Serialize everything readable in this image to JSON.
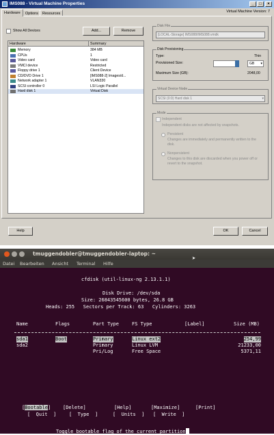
{
  "vm_window": {
    "title": "IMS088 - Virtual Machine Properties",
    "vm_name": "Virtual Machine Version: 7",
    "tabs": [
      "Hardware",
      "Options",
      "Resources"
    ],
    "show_all_devices": "Show All Devices",
    "add_button": "Add...",
    "remove_button": "Remove",
    "columns": [
      "Hardware",
      "Summary"
    ],
    "hardware": [
      {
        "icon": "memory-icon",
        "name": "Memory",
        "summary": "384 MB"
      },
      {
        "icon": "cpu-icon",
        "name": "CPUs",
        "summary": "1"
      },
      {
        "icon": "display-icon",
        "name": "Video card",
        "summary": "Video card"
      },
      {
        "icon": "pci-icon",
        "name": "VMCI device",
        "summary": "Restricted"
      },
      {
        "icon": "floppy-icon",
        "name": "Floppy drive 1",
        "summary": "Client Device"
      },
      {
        "icon": "cdrom-icon",
        "name": "CD/DVD Drive 1",
        "summary": "[IMS088-2] Images/d..."
      },
      {
        "icon": "network-icon",
        "name": "Network adapter 1",
        "summary": "VLAN330"
      },
      {
        "icon": "scsi-icon",
        "name": "SCSI controller 0",
        "summary": "LSI Logic Parallel"
      },
      {
        "icon": "disk-icon",
        "name": "Hard disk 1",
        "summary": "Virtual Disk"
      }
    ],
    "disk_file_label": "Disk File",
    "disk_file_value": "[LOCAL-Storage] IMS088/IMS088.vmdk",
    "provisioning_label": "Disk Provisioning",
    "type_label": "Type:",
    "type_value": "Thin",
    "provisioned_label": "Provisioned Size:",
    "provisioned_value": "",
    "provisioned_unit": "GB",
    "max_size_label": "Maximum Size (GB):",
    "max_size_value": "2048,00",
    "vdn_label": "Virtual Device Node",
    "vdn_value": "SCSI (0:0) Hard disk 1",
    "mode_label": "Mode",
    "independent_label": "Independent",
    "independent_desc": "Independent disks are not affected by snapshots.",
    "persistent_label": "Persistent",
    "persistent_desc": "Changes are immediately and permanently written to the disk.",
    "nonpersistent_label": "Nonpersistent",
    "nonpersistent_desc": "Changes to this disk are discarded when you power off or revert to the snapshot.",
    "help_button": "Help",
    "ok_button": "OK",
    "cancel_button": "Cancel"
  },
  "terminal": {
    "title": "tmuggendobler@tmuggendobler-laptop: ~",
    "menu": [
      "Datei",
      "Bearbeiten",
      "Ansicht",
      "Terminal",
      "Hilfe"
    ],
    "header_line": "cfdisk (util-linux-ng 2.13.1.1)",
    "disk_line": "Disk Drive: /dev/sda",
    "size_line": "Size: 26843545600 bytes, 26.8 GB",
    "geometry_line": "Heads: 255   Sectors per Track: 63   Cylinders: 3263",
    "columns": {
      "name": "Name",
      "flags": "Flags",
      "part_type": "Part Type",
      "fs_type": "FS Type",
      "label": "[Label]",
      "size": "Size (MB)"
    },
    "partitions": [
      {
        "name": "sda1",
        "flags": "Boot",
        "part_type": "Primary",
        "fs_type": "Linux ext2",
        "label": "",
        "size": "254,99"
      },
      {
        "name": "sda2",
        "flags": "",
        "part_type": "Primary",
        "fs_type": "Linux LVM",
        "label": "",
        "size": "21233,00"
      },
      {
        "name": "",
        "flags": "",
        "part_type": "Pri/Log",
        "fs_type": "Free Space",
        "label": "",
        "size": "5371,11"
      }
    ],
    "menu_row1": [
      "Bootable",
      "Delete",
      "Help",
      "Maximize",
      "Print"
    ],
    "menu_row2": [
      "Quit",
      "Type",
      "Units",
      "Write"
    ],
    "status_line": "Toggle bootable flag of the current partition",
    "colors": {
      "background": "#300a24",
      "highlight": "#c5c5c5"
    }
  }
}
